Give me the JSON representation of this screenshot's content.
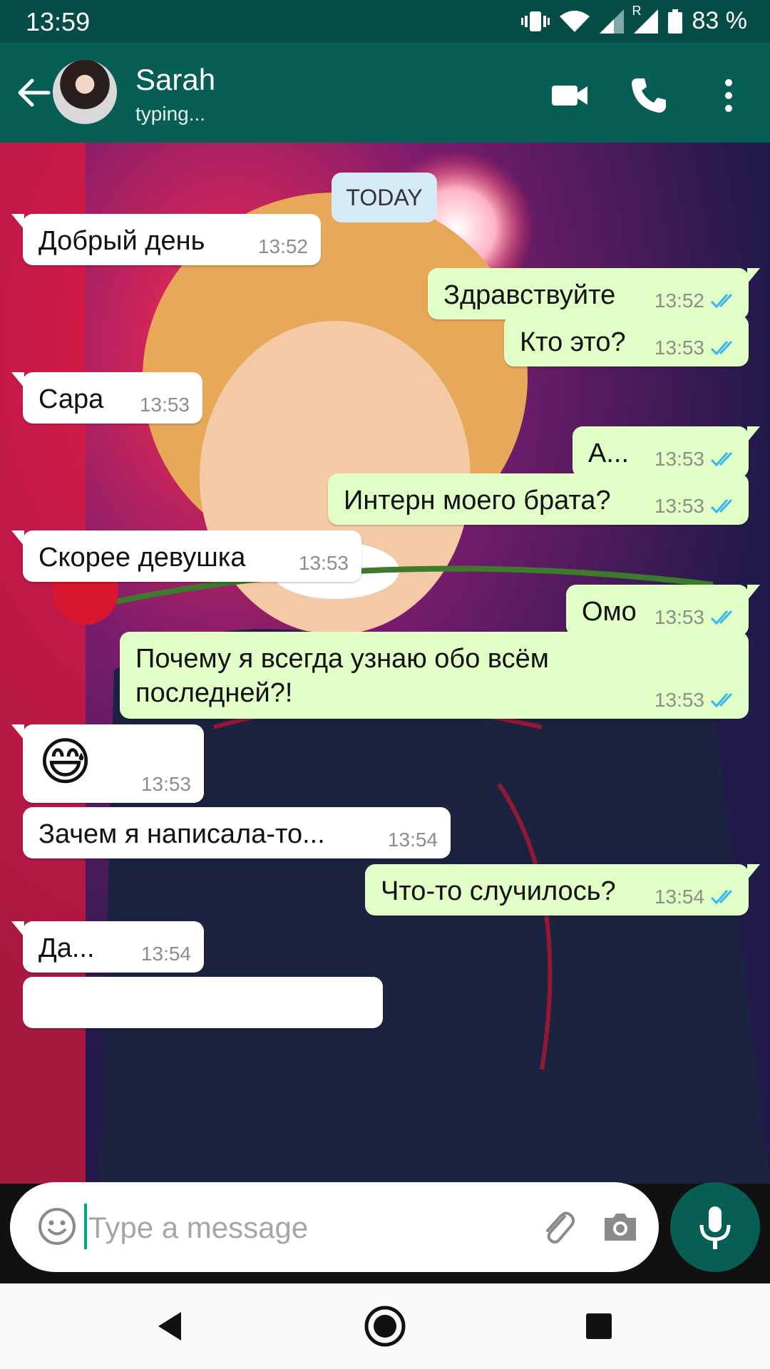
{
  "status_bar": {
    "time": "13:59",
    "battery": "83 %",
    "roaming": "R"
  },
  "header": {
    "contact_name": "Sarah",
    "contact_status": "typing..."
  },
  "chat": {
    "date_chip": "TODAY",
    "messages": [
      {
        "dir": "in",
        "text": "Добрый день",
        "time": "13:52"
      },
      {
        "dir": "out",
        "text": "Здравствуйте",
        "time": "13:52"
      },
      {
        "dir": "out",
        "text": "Кто это?",
        "time": "13:53"
      },
      {
        "dir": "in",
        "text": "Сара",
        "time": "13:53"
      },
      {
        "dir": "out",
        "text": "А...",
        "time": "13:53"
      },
      {
        "dir": "out",
        "text": "Интерн моего брата?",
        "time": "13:53"
      },
      {
        "dir": "in",
        "text": "Скорее девушка",
        "time": "13:53"
      },
      {
        "dir": "out",
        "text": "Омо",
        "time": "13:53"
      },
      {
        "dir": "out",
        "text_line1": "Почему я всегда узнаю обо всём",
        "text_line2": "последней?!",
        "time": "13:53"
      },
      {
        "dir": "in",
        "emoji": "😅",
        "time": "13:53"
      },
      {
        "dir": "in",
        "text": "Зачем я написала-то...",
        "time": "13:54"
      },
      {
        "dir": "out",
        "text": "Что-то случилось?",
        "time": "13:54"
      },
      {
        "dir": "in",
        "text": "Да...",
        "time": "13:54"
      }
    ]
  },
  "input": {
    "placeholder": "Type a message"
  },
  "colors": {
    "header": "#075e54",
    "status_bar": "#064d47",
    "outgoing_bubble": "#e1fec6",
    "incoming_bubble": "#ffffff",
    "read_ticks": "#34b7f1"
  },
  "icons": [
    "back-arrow",
    "video-call",
    "voice-call",
    "more-vert",
    "emoji",
    "attach",
    "camera",
    "mic",
    "nav-back",
    "nav-home",
    "nav-recents"
  ]
}
